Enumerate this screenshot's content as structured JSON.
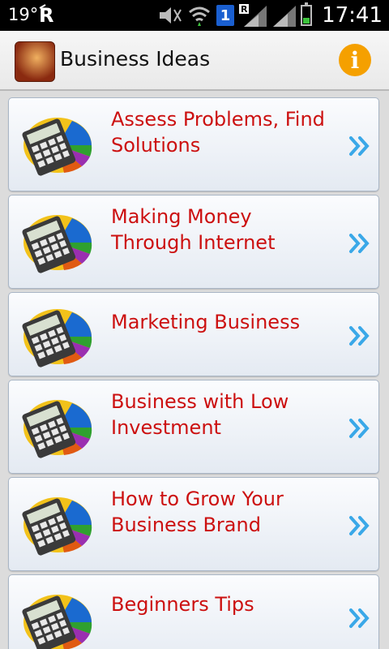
{
  "status_bar": {
    "temperature": "19°",
    "sim_slot": "1",
    "time": "17:41",
    "icons": [
      "r-logo-icon",
      "mute-icon",
      "wifi-icon",
      "sim-badge-icon",
      "signal-r-icon",
      "signal-icon",
      "battery-icon"
    ]
  },
  "app": {
    "title": "Business Ideas",
    "info_icon": "i"
  },
  "list": {
    "items": [
      {
        "label": "Assess Problems, Find Solutions",
        "icon": "calculator-chart-icon"
      },
      {
        "label": "Making Money Through Internet",
        "icon": "calculator-chart-icon"
      },
      {
        "label": "Marketing Business",
        "icon": "calculator-chart-icon"
      },
      {
        "label": "Business with Low Investment",
        "icon": "calculator-chart-icon"
      },
      {
        "label": "How to Grow Your Business Brand",
        "icon": "calculator-chart-icon"
      },
      {
        "label": "Beginners Tips",
        "icon": "calculator-chart-icon"
      }
    ]
  },
  "colors": {
    "item_text": "#cc1010",
    "chevron": "#3aa8e8",
    "info_button": "#f5a000"
  }
}
